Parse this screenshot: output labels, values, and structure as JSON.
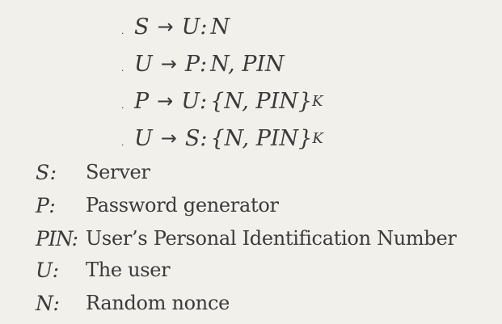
{
  "protocol_steps": [
    {
      "from": "S",
      "to": "U",
      "message": "N",
      "key": ""
    },
    {
      "from": "U",
      "to": "P",
      "message": "N, PIN",
      "key": ""
    },
    {
      "from": "P",
      "to": "U",
      "message": "{N, PIN}",
      "key": "K"
    },
    {
      "from": "U",
      "to": "S",
      "message": "{N, PIN}",
      "key": "K"
    }
  ],
  "arrow": "→",
  "separator": ":",
  "legend": [
    {
      "symbol": "S:",
      "description": "Server"
    },
    {
      "symbol": "P:",
      "description": "Password generator"
    },
    {
      "symbol": "PIN:",
      "description": "User’s Personal Identification Number"
    },
    {
      "symbol": "U:",
      "description": "The user"
    },
    {
      "symbol": "N:",
      "description": "Random nonce"
    }
  ],
  "colors": {
    "background": "#f2f0ea",
    "text": "#3a3a3a"
  }
}
